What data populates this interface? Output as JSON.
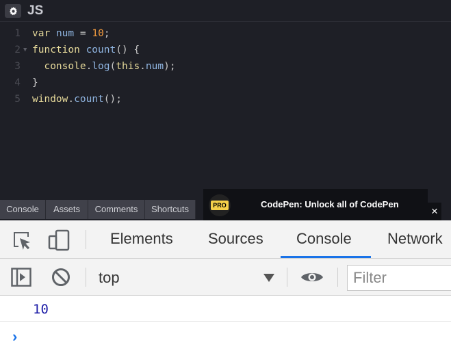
{
  "editor": {
    "title": "JS",
    "lines": [
      {
        "n": "1",
        "tokens": [
          [
            "kw",
            "var"
          ],
          [
            "pl",
            " "
          ],
          [
            "prop",
            "num"
          ],
          [
            "pl",
            " = "
          ],
          [
            "num",
            "10"
          ],
          [
            "pl",
            ";"
          ]
        ]
      },
      {
        "n": "2",
        "tokens": [
          [
            "kw",
            "function"
          ],
          [
            "pl",
            " "
          ],
          [
            "fn",
            "count"
          ],
          [
            "pl",
            "() {"
          ]
        ]
      },
      {
        "n": "3",
        "tokens": [
          [
            "pl",
            "  "
          ],
          [
            "kw",
            "console"
          ],
          [
            "pl",
            "."
          ],
          [
            "fn",
            "log"
          ],
          [
            "pl",
            "("
          ],
          [
            "kw",
            "this"
          ],
          [
            "pl",
            "."
          ],
          [
            "prop",
            "num"
          ],
          [
            "pl",
            ");"
          ]
        ]
      },
      {
        "n": "4",
        "tokens": [
          [
            "pl",
            "}"
          ]
        ]
      },
      {
        "n": "5",
        "tokens": [
          [
            "kw",
            "window"
          ],
          [
            "pl",
            "."
          ],
          [
            "fn",
            "count"
          ],
          [
            "pl",
            "();"
          ]
        ]
      }
    ]
  },
  "bottom_bar": {
    "buttons": [
      "Console",
      "Assets",
      "Comments",
      "Shortcuts"
    ]
  },
  "promo": {
    "badge": "PRO",
    "text": "CodePen: Unlock all of CodePen",
    "close": "×"
  },
  "devtools": {
    "tabs": [
      "Elements",
      "Sources",
      "Console",
      "Network"
    ],
    "active_tab": "Console",
    "context": "top",
    "filter_placeholder": "Filter",
    "output": "10",
    "prompt": "›"
  },
  "colors": {
    "editor_bg": "#1e1f26",
    "accent": "#1a73e8",
    "number_output": "#1a1aa6"
  }
}
